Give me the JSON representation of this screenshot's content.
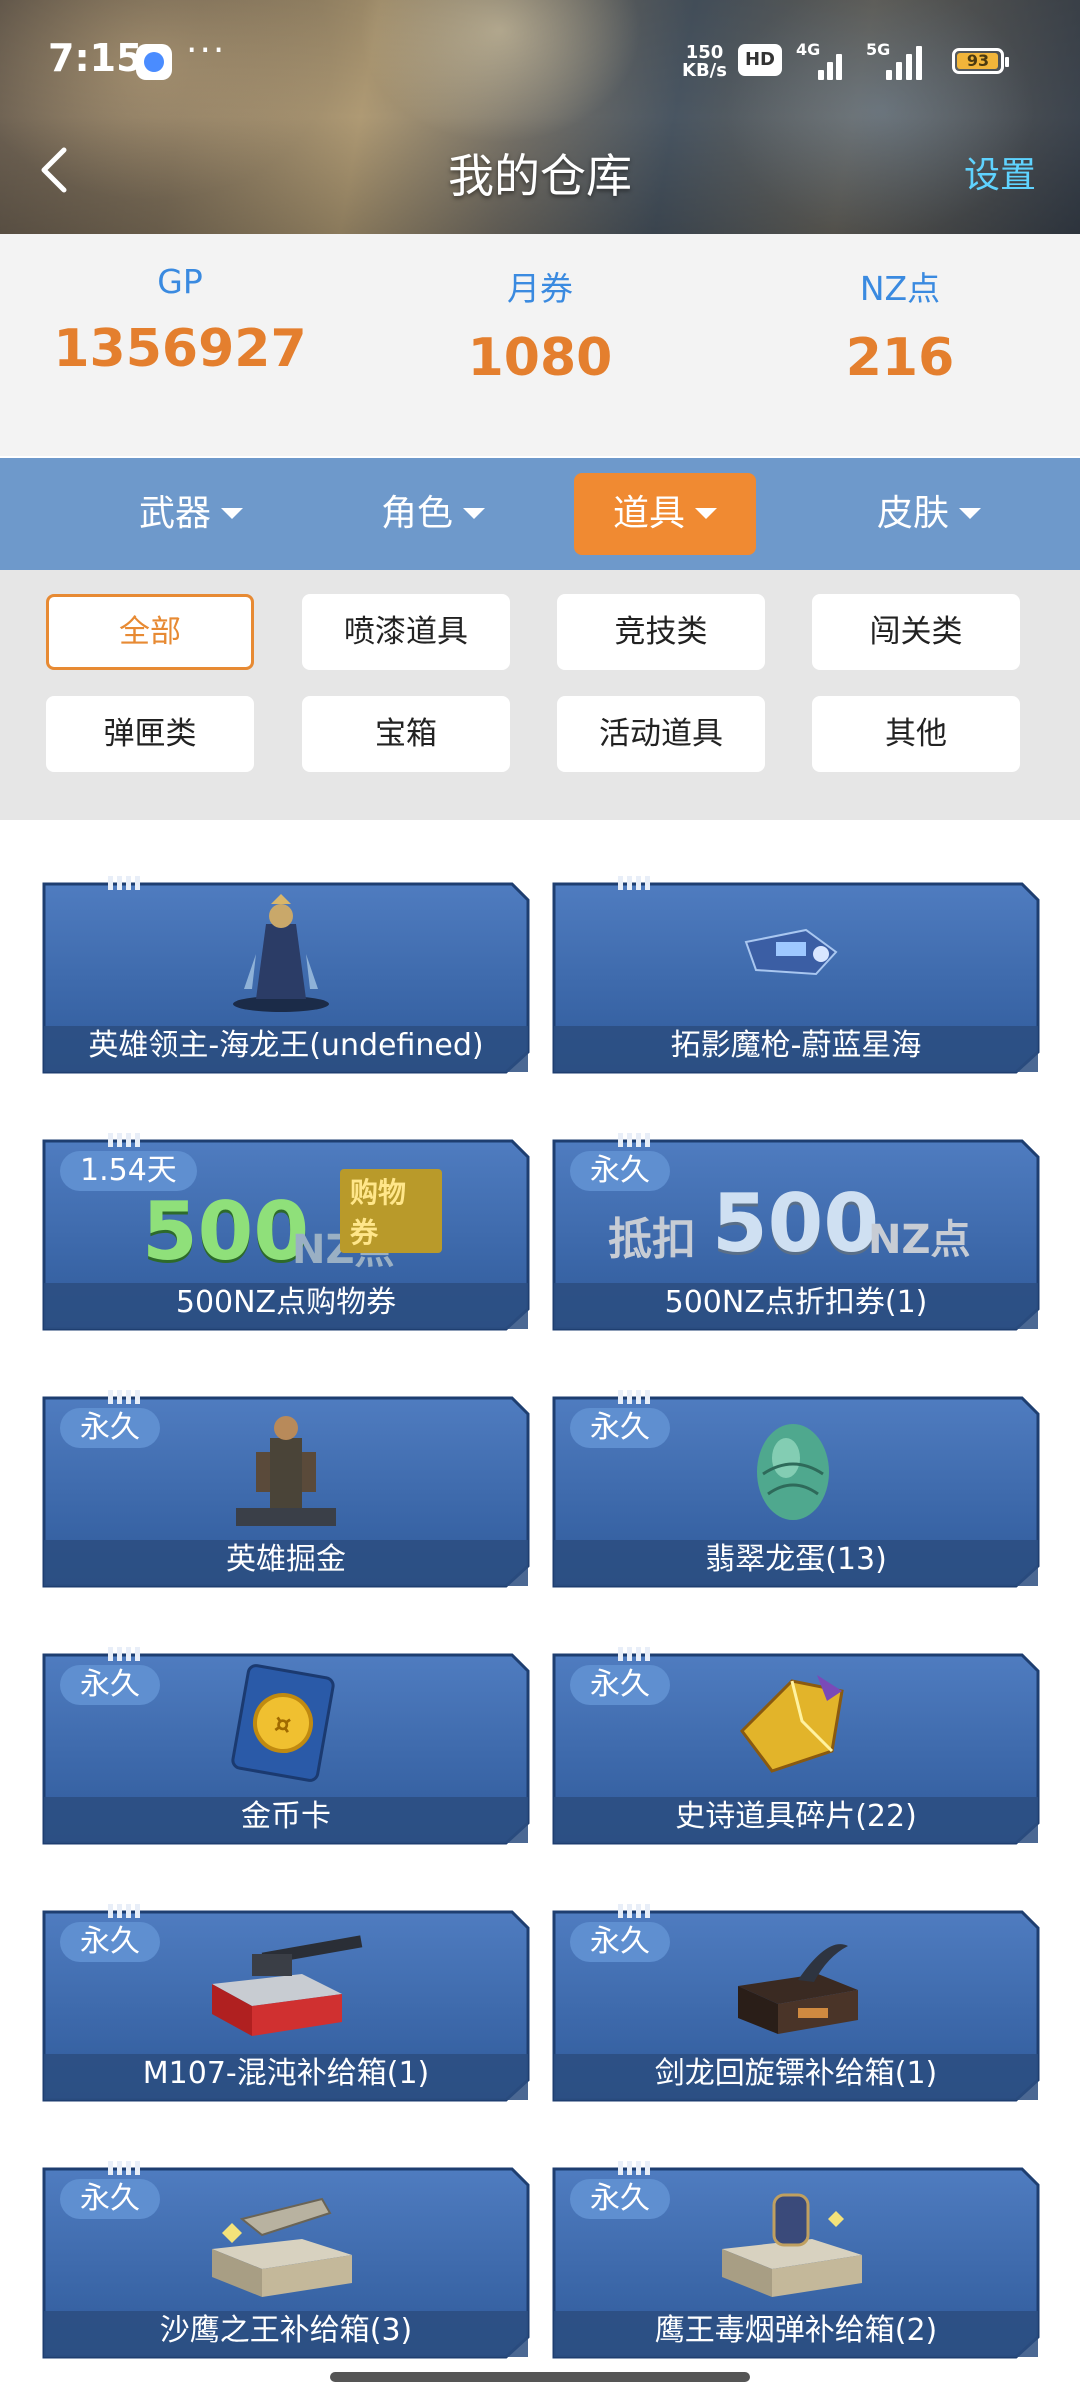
{
  "status_bar": {
    "time": "7:15",
    "more": "···",
    "speed_value": "150",
    "speed_unit": "KB/s",
    "hd": "HD",
    "net1": "4G",
    "net2": "5G",
    "battery": "93"
  },
  "nav": {
    "title": "我的仓库",
    "settings": "设置"
  },
  "currency": [
    {
      "label": "GP",
      "value": "1356927"
    },
    {
      "label": "月券",
      "value": "1080"
    },
    {
      "label": "NZ点",
      "value": "216"
    }
  ],
  "categories": [
    {
      "label": "武器"
    },
    {
      "label": "角色"
    },
    {
      "label": "道具"
    },
    {
      "label": "皮肤"
    }
  ],
  "filters": [
    "全部",
    "喷漆道具",
    "竞技类",
    "闯关类",
    "弹匣类",
    "宝箱",
    "活动道具",
    "其他"
  ],
  "items": [
    {
      "name": "英雄领主-海龙王(undefined)",
      "badge": ""
    },
    {
      "name": "拓影魔枪-蔚蓝星海",
      "badge": ""
    },
    {
      "name": "500NZ点购物券",
      "badge": "1.54天",
      "art_text": "500",
      "art_unit": "NZ点",
      "art_tag": "购物券"
    },
    {
      "name": "500NZ点折扣券(1)",
      "badge": "永久",
      "art_text": "500",
      "art_unit": "NZ点",
      "art_tag": "抵扣"
    },
    {
      "name": "英雄掘金",
      "badge": "永久"
    },
    {
      "name": "翡翠龙蛋(13)",
      "badge": "永久"
    },
    {
      "name": "金币卡",
      "badge": "永久"
    },
    {
      "name": "史诗道具碎片(22)",
      "badge": "永久"
    },
    {
      "name": "M107-混沌补给箱(1)",
      "badge": "永久"
    },
    {
      "name": "剑龙回旋镖补给箱(1)",
      "badge": "永久"
    },
    {
      "name": "沙鹰之王补给箱(3)",
      "badge": "永久"
    },
    {
      "name": "鹰王毒烟弹补给箱(2)",
      "badge": "永久"
    }
  ],
  "colors": {
    "accent_orange": "#e47f2e",
    "label_blue": "#3a8ae0",
    "category_bar": "#6e99cb",
    "settings_cyan": "#5fd3ff"
  }
}
